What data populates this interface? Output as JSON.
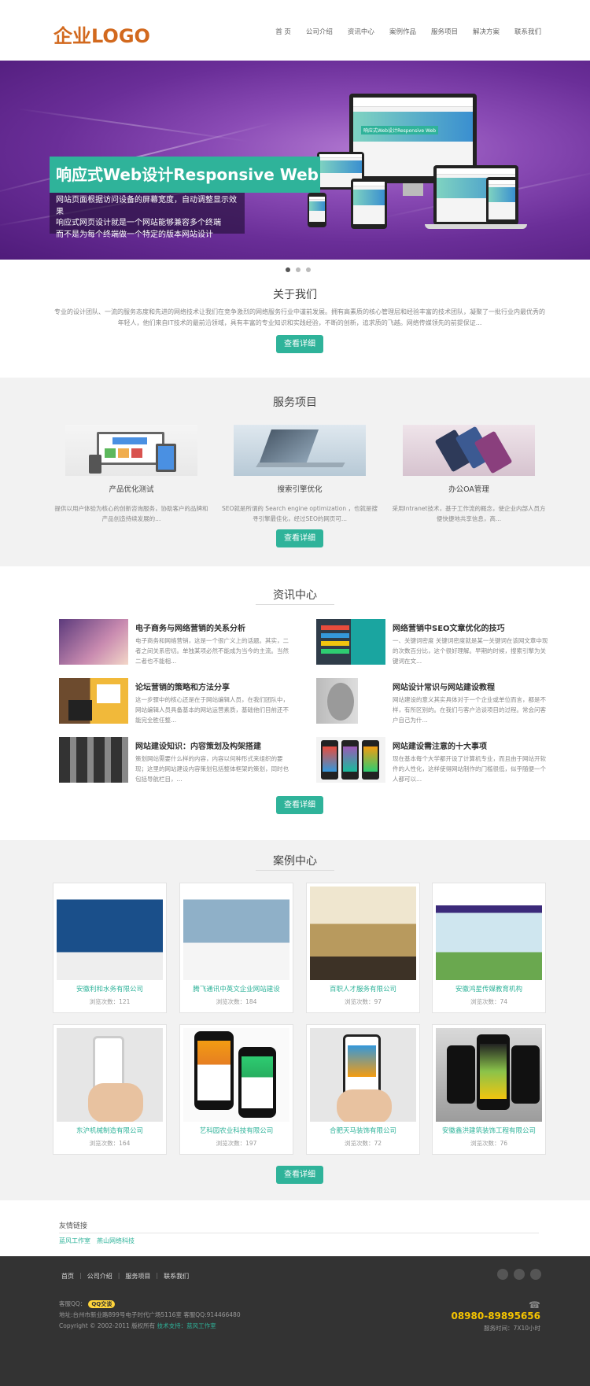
{
  "header": {
    "logo": "企业LOGO",
    "nav": [
      "首 页",
      "公司介绍",
      "资讯中心",
      "案例作品",
      "服务项目",
      "解决方案",
      "联系我们"
    ]
  },
  "banner": {
    "title": "响应式Web设计Responsive Web",
    "lines": [
      "网站页面根据访问设备的屏幕宽度，自动调整显示效果",
      "响应式网页设计就是一个网站能够兼容多个终端",
      "而不是为每个终端做一个特定的版本网站设计"
    ],
    "screen_tag": "响应式Web设计Responsive Web",
    "slides": 3,
    "active_slide": 1
  },
  "about": {
    "title": "关于我们",
    "text": "专业的设计团队、一流的服务态度和先进的网络技术让我们在竞争激烈的网络服务行业中谨前发展。拥有高素质的核心管理层和经验丰富的技术团队，凝聚了一批行业内最优秀的年轻人，他们来自IT技术的最前沿领域，具有丰富的专业知识和实践经验，不断的创新，追求质的飞越。网络传媒领先的前提保证...",
    "button": "查看详细"
  },
  "services": {
    "title": "服务项目",
    "items": [
      {
        "name": "产品优化测试",
        "desc": "提供以用户体验为核心的创新咨询服务，协助客户的品牌和产品创造持续发展的..."
      },
      {
        "name": "搜索引擎优化",
        "desc": "SEO就是所谓的 Search engine optimization ，也就是搜寻引擎最佳化，经过SEO的网页可..."
      },
      {
        "name": "办公OA管理",
        "desc": "采用Intranet技术，基于工作流的概念，使企业内部人员方便快捷地共享信息，高..."
      }
    ],
    "button": "查看详细"
  },
  "news": {
    "title": "资讯中心",
    "items": [
      {
        "title": "电子商务与网络营销的关系分析",
        "desc": "电子商务和网络营销，这是一个很广义上的话题。其实，二者之间关系密切。单独某项必然不能成为当今的主流。当然二者也不能相..."
      },
      {
        "title": "网络营销中SEO文章优化的技巧",
        "desc": "一、关键词密度 关键词密度就是某一关键词在该网文章中现的次数百分比，这个很好理解。早期的时候，搜索引擎为关键词在文..."
      },
      {
        "title": "论坛营销的策略和方法分享",
        "desc": "这一步骤中的核心还是在于网站编辑人员，在我们团队中，网站编辑人员具备基本的网站运营素质，基础他们目前还不能完全胜任整..."
      },
      {
        "title": "网站设计常识与网站建设教程",
        "desc": "网站建设的意义其实具体对于一个企业或单位而言，都是不样，有所区别的。在我们与客户洽谈项目的过程。常会问客户自己为什..."
      },
      {
        "title": "网站建设知识：内容策划及构架搭建",
        "desc": "策划网站需要什么样的内容，内容以何种形式来组织的要现；这里的网站建设内容策划包括整体框架的策划，同时也包括导航栏目，..."
      },
      {
        "title": "网站建设需注意的十大事项",
        "desc": "现在基本每个大学都开设了计算机专业，而且由于网站开软件的人性化，这样使得网站制作的门槛很低，似乎随便一个人都可以..."
      }
    ],
    "button": "查看详细"
  },
  "cases": {
    "title": "案例中心",
    "views_label": "浏览次数：",
    "items": [
      {
        "name": "安徽利和水务有限公司",
        "views": "121"
      },
      {
        "name": "腾飞通讯中英文企业网站建设",
        "views": "184"
      },
      {
        "name": "百职人才服务有限公司",
        "views": "97"
      },
      {
        "name": "安徽鸿星传媒教育机构",
        "views": "74"
      },
      {
        "name": "东沪机械制造有限公司",
        "views": "164"
      },
      {
        "name": "艺科园农业科技有限公司",
        "views": "197"
      },
      {
        "name": "合肥天马装饰有限公司",
        "views": "72"
      },
      {
        "name": "安徽鑫洪建筑装饰工程有限公司",
        "views": "76"
      }
    ],
    "button": "查看详细"
  },
  "links": {
    "title": "友情链接",
    "items": [
      "蓝风工作室",
      "燕山网络科技"
    ]
  },
  "footer": {
    "nav": [
      "首页",
      "公司介绍",
      "服务项目",
      "联系我们"
    ],
    "qq_label": "客服QQ：",
    "qq_badge": "QQ交谈",
    "address": "地址:台州市新业路899号电子时代广场5116室 客服QQ:914466480",
    "copyright": "Copyright © 2002-2011 版权所有",
    "tech": "技术支持：蓝风工作室",
    "phone": "08980-89895656",
    "hours": "服务时间：7X10小时"
  }
}
